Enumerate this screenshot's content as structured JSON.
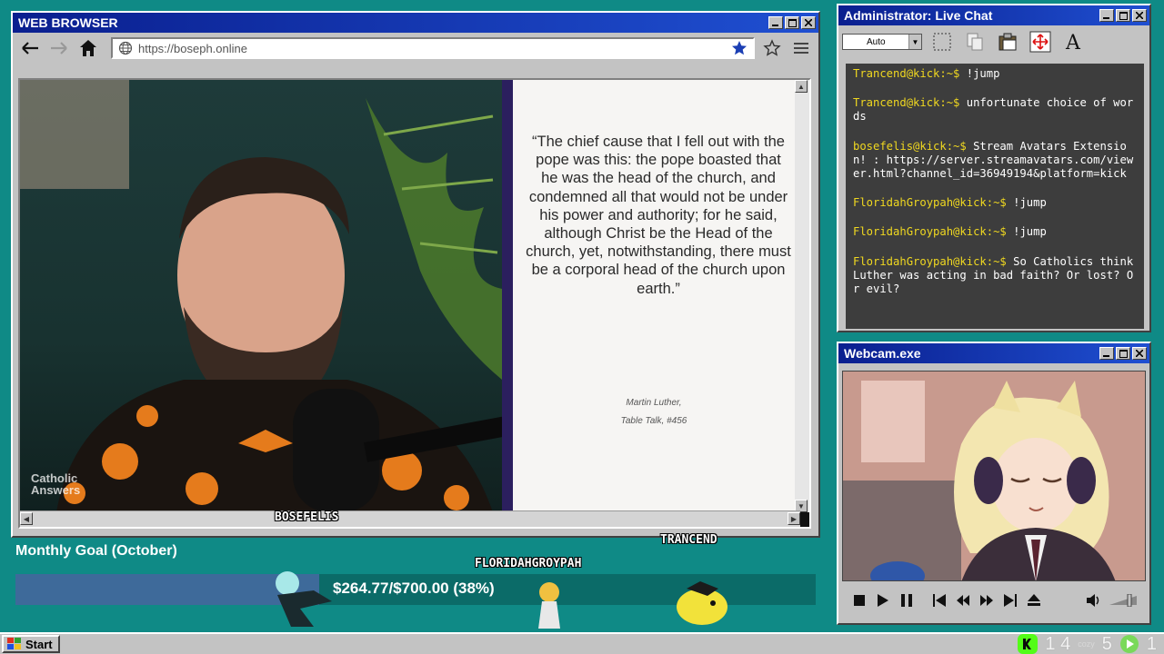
{
  "browser": {
    "title": "WEB BROWSER",
    "url": "https://boseph.online",
    "quote": "“The chief cause that I fell out with the pope was this: the pope boasted that he was the head of the church, and condemned all that would not be under his power and authority; for he said, although Christ be the Head of the church, yet, notwithstanding, there must be a corporal head of the church upon earth.”",
    "attribution_author": "Martin Luther,",
    "attribution_source": "Table Talk, #456",
    "watermark": "Catholic Answers"
  },
  "chat": {
    "title": "Administrator: Live Chat",
    "dropdown_value": "Auto",
    "messages": [
      {
        "user": "Trancend@kick:~$",
        "text": " !jump"
      },
      {
        "user": "Trancend@kick:~$",
        "text": " unfortunate choice of words"
      },
      {
        "user": "bosefelis@kick:~$",
        "text": " Stream Avatars Extension! : https://server.streamavatars.com/viewer.html?channel_id=36949194&platform=kick"
      },
      {
        "user": "FloridahGroypah@kick:~$",
        "text": " !jump"
      },
      {
        "user": "FloridahGroypah@kick:~$",
        "text": " !jump"
      },
      {
        "user": "FloridahGroypah@kick:~$",
        "text": " So Catholics think Luther was acting in bad faith? Or lost? Or evil?"
      }
    ]
  },
  "webcam": {
    "title": "Webcam.exe"
  },
  "overlay": {
    "goal_label": "Monthly Goal (October)",
    "goal_text": "$264.77/$700.00 (38%)",
    "goal_fraction": 0.38,
    "avatars": [
      "BOSEFELIS",
      "FLORIDAHGROYPAH",
      "TRANCEND"
    ]
  },
  "taskbar": {
    "start_label": "Start",
    "tray_kick_count": "1 4",
    "tray_cozy": "cozy",
    "tray_count_a": "5",
    "tray_count_b": "1"
  },
  "colors": {
    "desktop": "#0f8a86",
    "titlebar": "#0a1f8f",
    "chat_user": "#f0d820",
    "goal_fill": "#3e6a9a"
  }
}
